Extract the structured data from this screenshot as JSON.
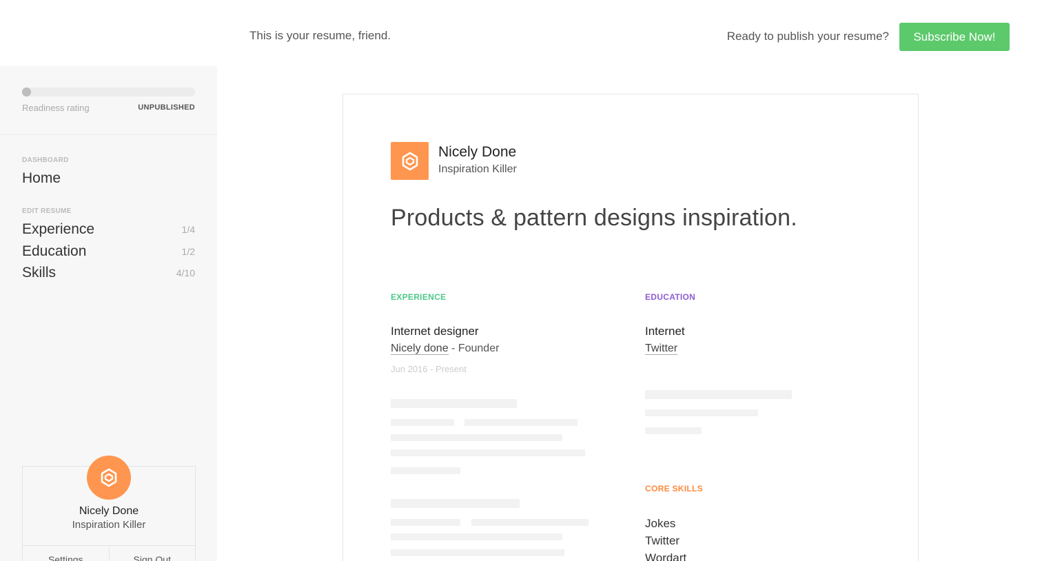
{
  "header": {
    "message": "This is your resume, friend.",
    "cta_text": "Ready to publish your resume?",
    "subscribe_label": "Subscribe Now!"
  },
  "readiness": {
    "label": "Readiness rating",
    "status": "UNPUBLISHED",
    "progress": 0
  },
  "sidebar": {
    "dashboard_label": "DASHBOARD",
    "home_label": "Home",
    "edit_label": "EDIT RESUME",
    "items": [
      {
        "label": "Experience",
        "count": "1/4"
      },
      {
        "label": "Education",
        "count": "1/2"
      },
      {
        "label": "Skills",
        "count": "4/10"
      }
    ]
  },
  "profile": {
    "name": "Nicely Done",
    "role": "Inspiration Killer",
    "settings_label": "Settings",
    "signout_label": "Sign Out"
  },
  "resume": {
    "name": "Nicely Done",
    "title": "Inspiration Killer",
    "headline": "Products & pattern designs inspiration.",
    "experience": {
      "heading": "EXPERIENCE",
      "job_title": "Internet designer",
      "company": "Nicely done",
      "role_suffix": " - Founder",
      "dates": "Jun 2016 - Present"
    },
    "education": {
      "heading": "EDUCATION",
      "school": "Internet",
      "program": "Twitter"
    },
    "skills": {
      "heading": "CORE SKILLS",
      "items": [
        "Jokes",
        "Twitter",
        "Wordart"
      ]
    }
  },
  "colors": {
    "accent_green": "#5cc96b",
    "brand_orange": "#ff964f",
    "experience_heading": "#4cc98a",
    "education_heading": "#8e5dd1",
    "skills_heading": "#ff8a3d"
  },
  "icons": {
    "logo": "hexagon-logo-icon"
  }
}
